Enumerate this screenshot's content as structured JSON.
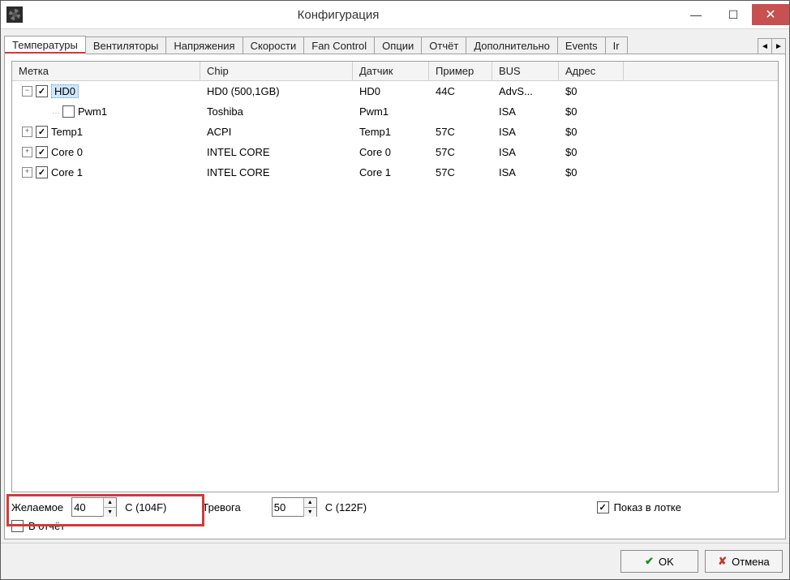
{
  "window": {
    "title": "Конфигурация"
  },
  "tabs": {
    "items": [
      "Температуры",
      "Вентиляторы",
      "Напряжения",
      "Скорости",
      "Fan Control",
      "Опции",
      "Отчёт",
      "Дополнительно",
      "Events",
      "Ir"
    ],
    "active_index": 0
  },
  "grid": {
    "columns": {
      "label": "Метка",
      "chip": "Chip",
      "sensor": "Датчик",
      "sample": "Пример",
      "bus": "BUS",
      "addr": "Адрес"
    },
    "rows": [
      {
        "depth": 0,
        "expander": "-",
        "checked": true,
        "selected": true,
        "label": "HD0",
        "chip": "HD0 (500,1GB)",
        "sensor": "HD0",
        "sample": "44C",
        "bus": "AdvS...",
        "addr": "$0"
      },
      {
        "depth": 1,
        "expander": "",
        "checked": false,
        "selected": false,
        "label": "Pwm1",
        "chip": "Toshiba",
        "sensor": "Pwm1",
        "sample": "",
        "bus": "ISA",
        "addr": "$0"
      },
      {
        "depth": 0,
        "expander": "+",
        "checked": true,
        "selected": false,
        "label": "Temp1",
        "chip": "ACPI",
        "sensor": "Temp1",
        "sample": "57C",
        "bus": "ISA",
        "addr": "$0"
      },
      {
        "depth": 0,
        "expander": "+",
        "checked": true,
        "selected": false,
        "label": "Core 0",
        "chip": "INTEL CORE",
        "sensor": "Core 0",
        "sample": "57C",
        "bus": "ISA",
        "addr": "$0"
      },
      {
        "depth": 0,
        "expander": "+",
        "checked": true,
        "selected": false,
        "label": "Core 1",
        "chip": "INTEL CORE",
        "sensor": "Core 1",
        "sample": "57C",
        "bus": "ISA",
        "addr": "$0"
      }
    ]
  },
  "controls": {
    "desired_label": "Желаемое",
    "desired_value": "40",
    "desired_unit": "C (104F)",
    "alarm_label": "Тревога",
    "alarm_value": "50",
    "alarm_unit": "C (122F)",
    "tray_checked": true,
    "tray_label": "Показ в лотке",
    "report_checked": false,
    "report_label": "В отчёт"
  },
  "footer": {
    "ok": "OK",
    "cancel": "Отмена"
  }
}
